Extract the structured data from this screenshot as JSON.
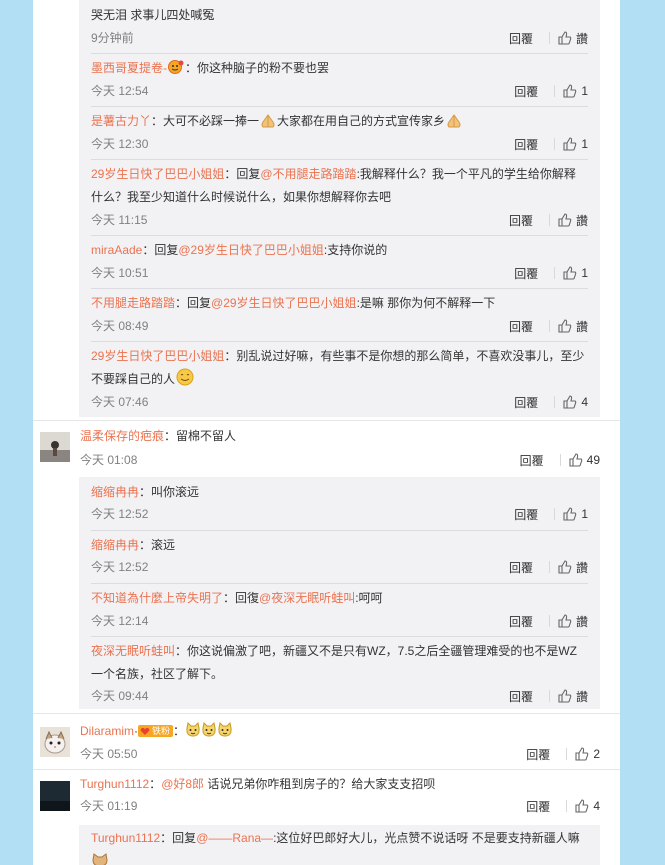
{
  "thread1": [
    {
      "user": "",
      "text": "哭无泪 求事儿四处喊冤",
      "time": "9分钟前",
      "reply": "回覆",
      "like": "讚"
    },
    {
      "user": "墨西哥夏提卷-",
      "text": "：你这种脑子的粉不要也罢",
      "time": "今天 12:54",
      "reply": "回覆",
      "like": "1"
    },
    {
      "user": "是薯古力丫",
      "text": "：大可不必踩一捧一",
      "text2": "大家都在用自己的方式宣传家乡",
      "time": "今天 12:30",
      "reply": "回覆",
      "like": "1"
    },
    {
      "user": "29岁生日快了巴巴小姐姐",
      "mid": "：回复",
      "mention": "@不用腿走路踏踏",
      "text": ":我解释什么？我一个平凡的学生给你解释",
      "text2": "什么？我至少知道什么时候说什么，如果你想解释你去吧",
      "time": "今天 11:15",
      "reply": "回覆",
      "like": "讚"
    },
    {
      "user": "miraAade",
      "mid": "：回复",
      "mention": "@29岁生日快了巴巴小姐姐",
      "text": ":支持你说的",
      "time": "今天 10:51",
      "reply": "回覆",
      "like": "1"
    },
    {
      "user": "不用腿走路踏踏",
      "mid": "：回复",
      "mention": "@29岁生日快了巴巴小姐姐",
      "text": ":是嘛 那你为何不解释一下",
      "time": "今天 08:49",
      "reply": "回覆",
      "like": "讚"
    },
    {
      "user": "29岁生日快了巴巴小姐姐",
      "text": "：别乱说过好嘛，有些事不是你想的那么简单，不喜欢没事儿，至少",
      "text2": "不要踩自己的人",
      "time": "今天 07:46",
      "reply": "回覆",
      "like": "4"
    }
  ],
  "comment2": {
    "user": "温柔保存的疤痕",
    "text": "：留棉不留人",
    "time": "今天 01:08",
    "reply": "回覆",
    "like": "49"
  },
  "thread2": [
    {
      "user": "缩缩冉冉",
      "text": "：叫你滚远",
      "time": "今天 12:52",
      "reply": "回覆",
      "like": "1"
    },
    {
      "user": "缩缩冉冉",
      "text": "：滚远",
      "time": "今天 12:52",
      "reply": "回覆",
      "like": "讚"
    },
    {
      "user": "不知道為什麼上帝失明了",
      "mid": "：回復",
      "mention": "@夜深无眠听蛙叫",
      "text": ":呵呵",
      "time": "今天 12:14",
      "reply": "回覆",
      "like": "讚"
    },
    {
      "user": "夜深无眠听蛙叫",
      "text": "：你这说偏激了吧，新疆又不是只有WZ，7.5之后全疆管理难受的也不是WZ",
      "text2": "一个名族，社区了解下。",
      "time": "今天 09:44",
      "reply": "回覆",
      "like": "讚"
    }
  ],
  "comment3": {
    "user": "Dilaramim",
    "badge": "铁粉",
    "sep": "·",
    "colon": "：",
    "time": "今天 05:50",
    "reply": "回覆",
    "like": "2"
  },
  "comment4": {
    "user": "Turghun1112",
    "colon": "：",
    "mention": "@好8郎",
    "text": " 话说兄弟你咋租到房子的？给大家支支招呗",
    "time": "今天 01:19",
    "reply": "回覆",
    "like": "4"
  },
  "thread3": [
    {
      "user": "Turghun1112",
      "mid": "：回复",
      "mention": "@——Rana—",
      "text": ":这位好巴郎好大儿，光点赞不说话呀 不是要支持新疆人嘛"
    }
  ],
  "colors": {
    "link": "#eb7350",
    "background": "#b3dff5",
    "nested_bg": "#f2f2f5"
  }
}
